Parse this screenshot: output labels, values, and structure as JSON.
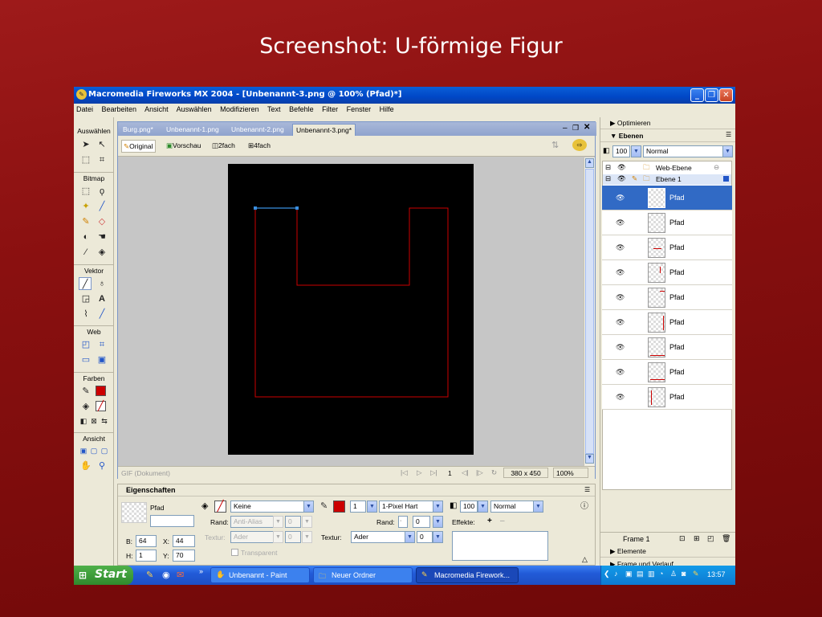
{
  "slide": {
    "title": "Screenshot: U-förmige Figur"
  },
  "window": {
    "title": "Macromedia Fireworks MX 2004 - [Unbenannt-3.png @ 100% (Pfad)*]",
    "menu": [
      "Datei",
      "Bearbeiten",
      "Ansicht",
      "Auswählen",
      "Modifizieren",
      "Text",
      "Befehle",
      "Filter",
      "Fenster",
      "Hilfe"
    ]
  },
  "toolbox": {
    "sections": [
      "Auswählen",
      "Bitmap",
      "Vektor",
      "Web",
      "Farben",
      "Ansicht"
    ]
  },
  "document": {
    "tabs": [
      "Burg.png*",
      "Unbenannt-1.png",
      "Unbenannt-2.png",
      "Unbenannt-3.png*"
    ],
    "views": [
      "Original",
      "Vorschau",
      "2fach",
      "4fach"
    ],
    "status_left": "GIF (Dokument)",
    "frame": "1",
    "size": "380 x 450",
    "zoom": "100%"
  },
  "properties": {
    "title": "Eigenschaften",
    "object_type": "Pfad",
    "b_label": "B:",
    "b_value": "64",
    "x_label": "X:",
    "x_value": "44",
    "h_label": "H:",
    "h_value": "1",
    "y_label": "Y:",
    "y_value": "70",
    "fill_value": "Keine",
    "rand_label": "Rand:",
    "rand_value": "Anti-Alias",
    "rand_num": "0",
    "textur_label": "Textur:",
    "textur_value": "Ader",
    "textur_num": "0",
    "transparent_label": "Transparent",
    "stroke_size": "1",
    "stroke_type": "1-Pixel Hart",
    "stroke_rand_label": "Rand:",
    "stroke_rand_value": "0",
    "stroke_textur_label": "Textur:",
    "stroke_textur_value": "Ader",
    "stroke_textur_num": "0",
    "opacity": "100",
    "blend": "Normal",
    "effects_label": "Effekte:"
  },
  "panels": {
    "optimize": "Optimieren",
    "layers_title": "Ebenen",
    "opacity": "100",
    "blend": "Normal",
    "web_layer": "Web-Ebene",
    "layer1": "Ebene 1",
    "objects": [
      "Pfad",
      "Pfad",
      "Pfad",
      "Pfad",
      "Pfad",
      "Pfad",
      "Pfad",
      "Pfad",
      "Pfad"
    ],
    "frame_label": "Frame 1",
    "elements": "Elemente",
    "frames": "Frame und Verlauf"
  },
  "taskbar": {
    "start": "Start",
    "tasks": [
      "Unbenannt - Paint",
      "Neuer Ordner",
      "Macromedia Firework..."
    ],
    "clock": "13:57"
  },
  "colors": {
    "stroke": "#cc0000",
    "selected_path": "#3a8fe0",
    "canvas": "#000000"
  }
}
